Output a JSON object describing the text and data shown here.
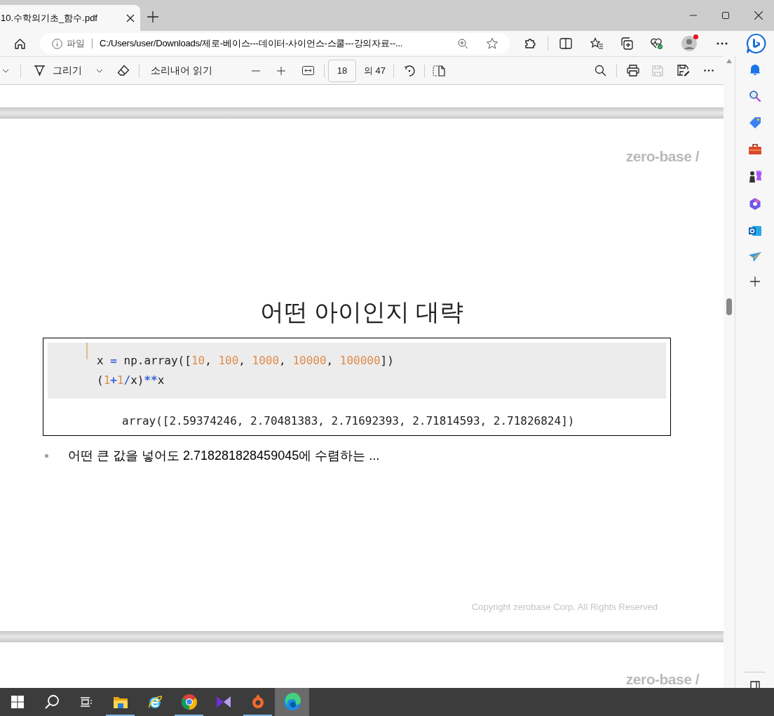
{
  "tab": {
    "title": "10.수학의기초_함수.pdf"
  },
  "address_bar": {
    "scheme_label": "파일",
    "url": "C:/Users/user/Downloads/제로-베이스---데이터-사이언스-스쿨---강의자료--..."
  },
  "pdf_toolbar": {
    "draw_label": "그리기",
    "read_aloud_label": "소리내어 읽기",
    "page_number": "18",
    "page_count": "의 47"
  },
  "slide": {
    "brand": "zero-base /",
    "title": "어떤 아이인지 대략",
    "code_lines": [
      {
        "tokens": [
          {
            "kind": "text",
            "text": "x "
          },
          {
            "kind": "op",
            "text": "="
          },
          {
            "kind": "text",
            "text": " np.array(["
          },
          {
            "kind": "num",
            "text": "10"
          },
          {
            "kind": "text",
            "text": ", "
          },
          {
            "kind": "num",
            "text": "100"
          },
          {
            "kind": "text",
            "text": ", "
          },
          {
            "kind": "num",
            "text": "1000"
          },
          {
            "kind": "text",
            "text": ", "
          },
          {
            "kind": "num",
            "text": "10000"
          },
          {
            "kind": "text",
            "text": ", "
          },
          {
            "kind": "num",
            "text": "100000"
          },
          {
            "kind": "text",
            "text": "])"
          }
        ]
      },
      {
        "tokens": [
          {
            "kind": "text",
            "text": "("
          },
          {
            "kind": "num",
            "text": "1"
          },
          {
            "kind": "op",
            "text": "+"
          },
          {
            "kind": "num",
            "text": "1"
          },
          {
            "kind": "op",
            "text": "/"
          },
          {
            "kind": "text",
            "text": "x)"
          },
          {
            "kind": "op",
            "text": "**"
          },
          {
            "kind": "text",
            "text": "x"
          }
        ]
      }
    ],
    "output": "array([2.59374246, 2.70481383, 2.71692393, 2.71814593, 2.71826824])",
    "bullets": [
      "어떤 큰 값을 넣어도 2.718281828459045에 수렴하는 ..."
    ],
    "copyright": "Copyright zerobase Corp. All Rights Reserved"
  },
  "next_page": {
    "brand": "zero-base /"
  },
  "taskbar": [
    {
      "kind": "start",
      "running": false,
      "selected": false
    },
    {
      "kind": "search",
      "running": false,
      "selected": false
    },
    {
      "kind": "taskview",
      "running": false,
      "selected": false
    },
    {
      "kind": "folder",
      "running": true,
      "selected": false
    },
    {
      "kind": "ie",
      "running": false,
      "selected": false
    },
    {
      "kind": "chrome",
      "running": true,
      "selected": false
    },
    {
      "kind": "vs",
      "running": false,
      "selected": false
    },
    {
      "kind": "origin",
      "running": true,
      "selected": false
    },
    {
      "kind": "edge",
      "running": false,
      "selected": true
    }
  ]
}
